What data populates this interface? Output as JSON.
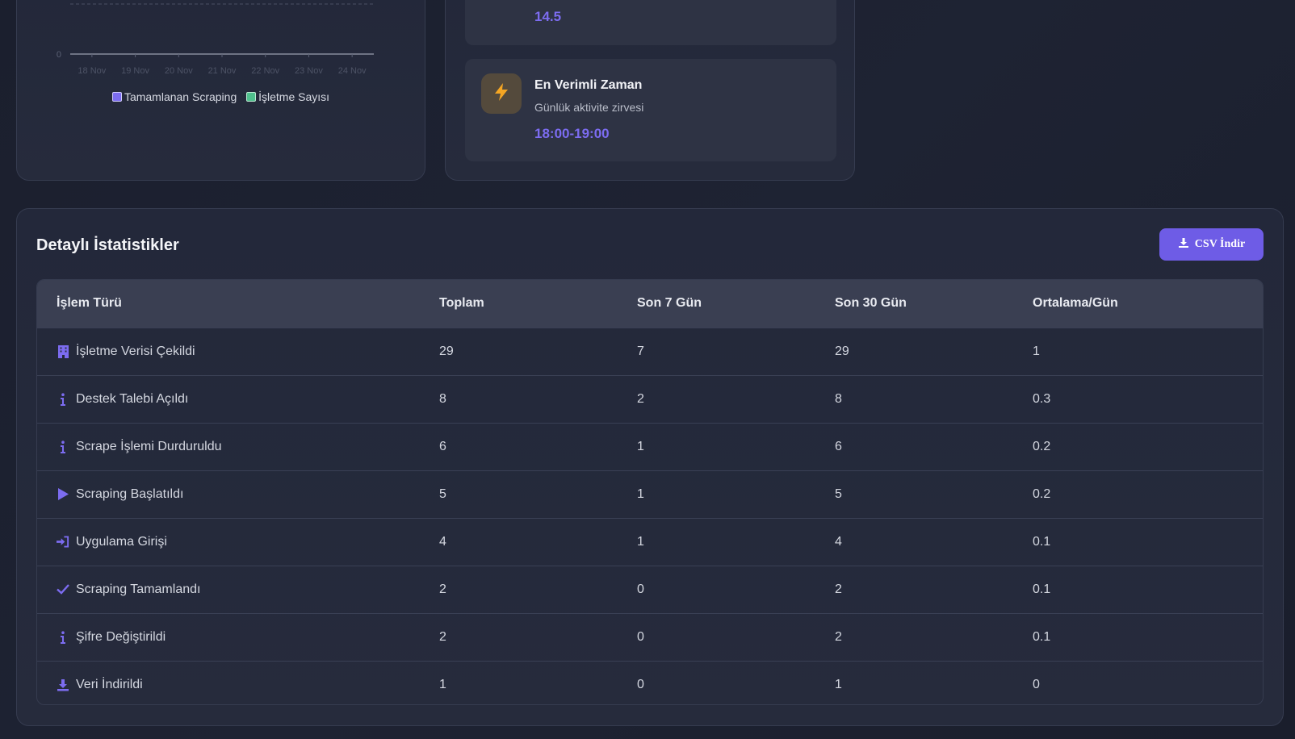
{
  "chart_card": {
    "chart_data": {
      "type": "line",
      "categories": [
        "18 Nov",
        "19 Nov",
        "20 Nov",
        "21 Nov",
        "22 Nov",
        "23 Nov",
        "24 Nov"
      ],
      "y_tick_visible": "0",
      "series": [
        {
          "name": "Tamamlanan Scraping",
          "color": "#7c6cf0"
        },
        {
          "name": "İşletme Sayısı",
          "color": "#4fc08d"
        }
      ],
      "legend_position": "bottom",
      "grid": true
    }
  },
  "insights": {
    "top": {
      "value": "14.5"
    },
    "best_time": {
      "title": "En Verimli Zaman",
      "subtitle": "Günlük aktivite zirvesi",
      "value": "18:00-19:00",
      "icon": "lightning-icon"
    }
  },
  "stats": {
    "title": "Detaylı İstatistikler",
    "csv_button_label": "CSV İndir",
    "columns": [
      "İşlem Türü",
      "Toplam",
      "Son 7 Gün",
      "Son 30 Gün",
      "Ortalama/Gün"
    ],
    "rows": [
      {
        "icon": "building-icon",
        "type": "İşletme Verisi Çekildi",
        "total": "29",
        "last7": "7",
        "last30": "29",
        "avg": "1"
      },
      {
        "icon": "info-icon",
        "type": "Destek Talebi Açıldı",
        "total": "8",
        "last7": "2",
        "last30": "8",
        "avg": "0.3"
      },
      {
        "icon": "info-icon",
        "type": "Scrape İşlemi Durduruldu",
        "total": "6",
        "last7": "1",
        "last30": "6",
        "avg": "0.2"
      },
      {
        "icon": "play-icon",
        "type": "Scraping Başlatıldı",
        "total": "5",
        "last7": "1",
        "last30": "5",
        "avg": "0.2"
      },
      {
        "icon": "login-icon",
        "type": "Uygulama Girişi",
        "total": "4",
        "last7": "1",
        "last30": "4",
        "avg": "0.1"
      },
      {
        "icon": "check-icon",
        "type": "Scraping Tamamlandı",
        "total": "2",
        "last7": "0",
        "last30": "2",
        "avg": "0.1"
      },
      {
        "icon": "info-icon",
        "type": "Şifre Değiştirildi",
        "total": "2",
        "last7": "0",
        "last30": "2",
        "avg": "0.1"
      },
      {
        "icon": "download-icon",
        "type": "Veri İndirildi",
        "total": "1",
        "last7": "0",
        "last30": "1",
        "avg": "0"
      }
    ]
  },
  "colors": {
    "accent": "#7c6cf0",
    "button": "#6e5ce6",
    "green": "#4fc08d",
    "lightning": "#f5a623"
  }
}
